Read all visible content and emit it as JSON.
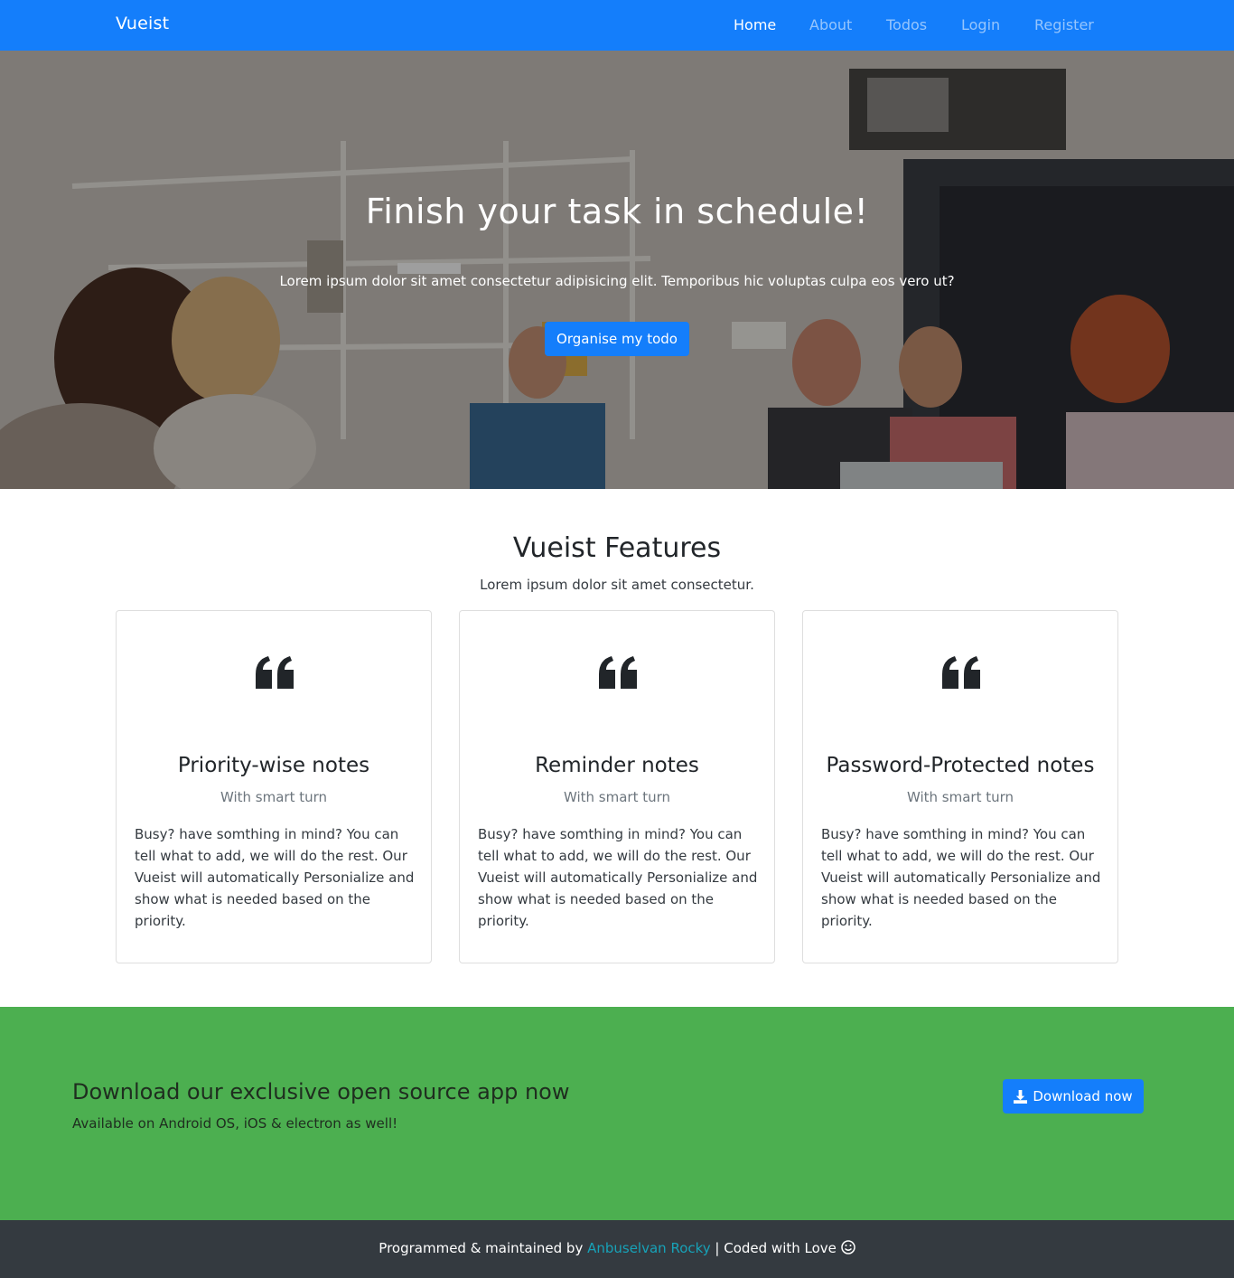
{
  "colors": {
    "primary": "#147efb",
    "navbar": "#147efb",
    "download_section": "#4caf50",
    "footer": "#343a40",
    "footer_link": "#17a2b8"
  },
  "navbar": {
    "brand": "Vueist",
    "links": [
      {
        "label": "Home",
        "active": true
      },
      {
        "label": "About",
        "active": false
      },
      {
        "label": "Todos",
        "active": false
      },
      {
        "label": "Login",
        "active": false
      },
      {
        "label": "Register",
        "active": false
      }
    ]
  },
  "hero": {
    "title": "Finish your task in schedule!",
    "subtitle": "Lorem ipsum dolor sit amet consectetur adipisicing elit. Temporibus hic voluptas culpa eos vero ut?",
    "button_label": "Organise my todo"
  },
  "features": {
    "title": "Vueist Features",
    "subtitle": "Lorem ipsum dolor sit amet consectetur.",
    "cards": [
      {
        "icon": "quote-left-icon",
        "title": "Priority-wise notes",
        "subtitle": "With smart turn",
        "text": "Busy? have somthing in mind? You can tell what to add, we will do the rest. Our Vueist will automatically Personialize and show what is needed based on the priority."
      },
      {
        "icon": "quote-left-icon",
        "title": "Reminder notes",
        "subtitle": "With smart turn",
        "text": "Busy? have somthing in mind? You can tell what to add, we will do the rest. Our Vueist will automatically Personialize and show what is needed based on the priority."
      },
      {
        "icon": "quote-left-icon",
        "title": "Password-Protected notes",
        "subtitle": "With smart turn",
        "text": "Busy? have somthing in mind? You can tell what to add, we will do the rest. Our Vueist will automatically Personialize and show what is needed based on the priority."
      }
    ]
  },
  "download": {
    "title": "Download our exclusive open source app now",
    "subtitle": "Available on Android OS, iOS & electron as well!",
    "button_label": "Download now",
    "button_icon": "download-icon"
  },
  "footer": {
    "prefix": "Programmed & maintained by ",
    "author": "Anbuselvan Rocky",
    "suffix": " | Coded with Love ",
    "icon": "smile-icon"
  }
}
